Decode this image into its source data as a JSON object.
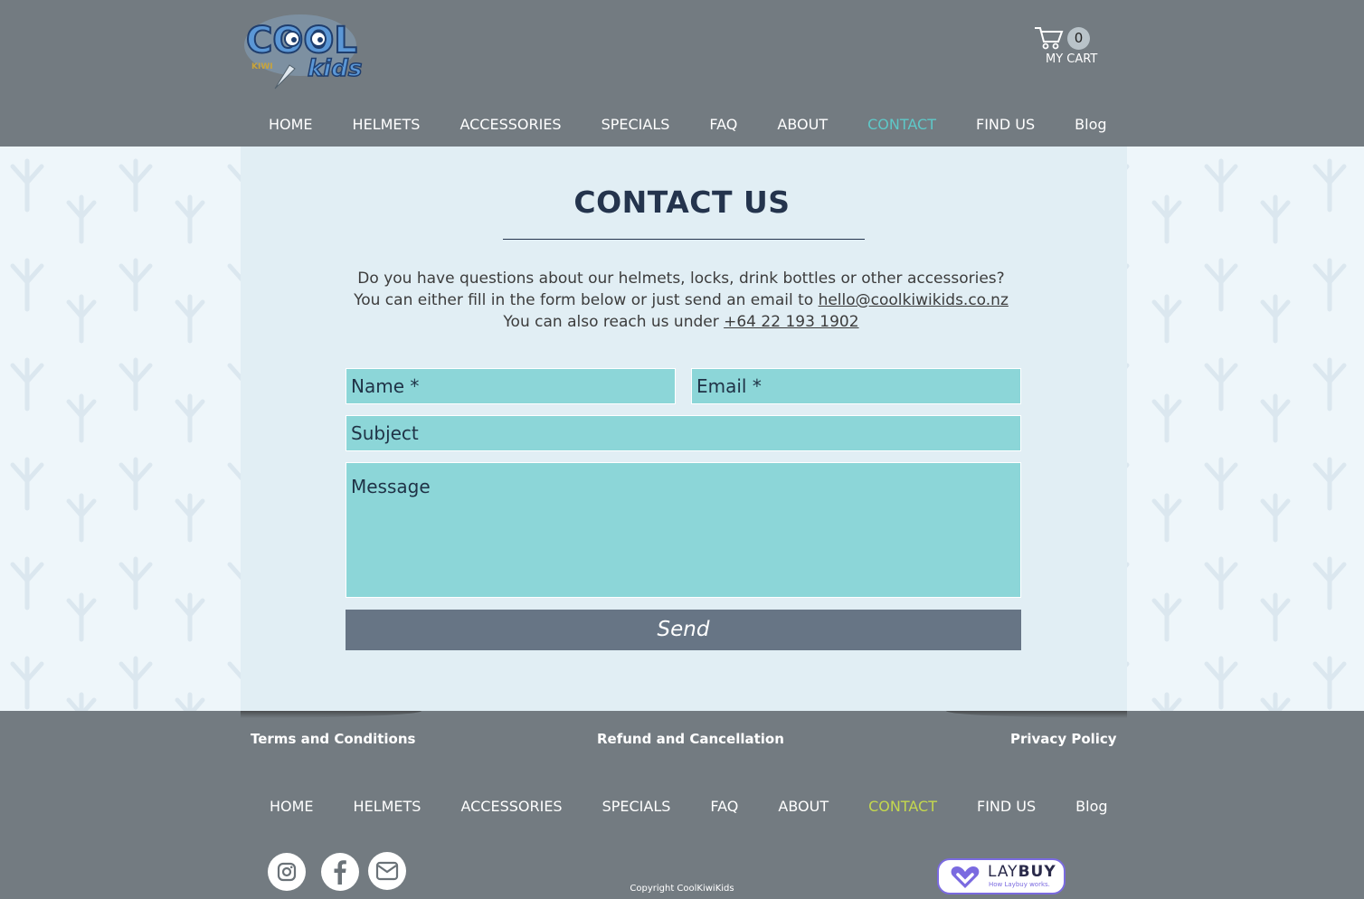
{
  "brand": {
    "logo_word_top": "COOL",
    "logo_word_small": "KIWI",
    "logo_word_bottom": "kids"
  },
  "cart": {
    "count": "0",
    "label": "MY CART"
  },
  "nav": {
    "items": [
      "HOME",
      "HELMETS",
      "ACCESSORIES",
      "SPECIALS",
      "FAQ",
      "ABOUT",
      "CONTACT",
      "FIND US",
      "Blog"
    ],
    "active_index": 6
  },
  "contact": {
    "title": "CONTACT US",
    "intro_line1": "Do you have questions about our helmets, locks, drink bottles or other accessories?",
    "intro_line2_prefix": "You can either fill in the form below or just send an email to ",
    "email": "hello@coolkiwikids.co.nz",
    "intro_line3_prefix": "You can also reach us under ",
    "phone": "+64 22 193 1902"
  },
  "form": {
    "name_placeholder": "Name *",
    "email_placeholder": "Email *",
    "subject_placeholder": "Subject",
    "message_placeholder": "Message",
    "send_label": "Send"
  },
  "footer": {
    "terms": "Terms and Conditions",
    "refund": "Refund and Cancellation",
    "privacy": "Privacy Policy",
    "nav_items": [
      "HOME",
      "HELMETS",
      "ACCESSORIES",
      "SPECIALS",
      "FAQ",
      "ABOUT",
      "CONTACT",
      "FIND US",
      "Blog"
    ],
    "copyright": "Copyright CoolKiwiKids",
    "laybuy_light": "LAY",
    "laybuy_bold": "BUY",
    "laybuy_sub": "How Laybuy works."
  },
  "colors": {
    "header_bg": "#737b81",
    "accent_active_top": "#5ec8c8",
    "accent_active_footer": "#c4d84e",
    "field_bg": "#8cd6d8",
    "send_bg": "#677585",
    "title_color": "#24344d"
  },
  "icons": [
    "cart-icon",
    "instagram-icon",
    "facebook-icon",
    "mail-icon",
    "laybuy-heart-icon"
  ]
}
